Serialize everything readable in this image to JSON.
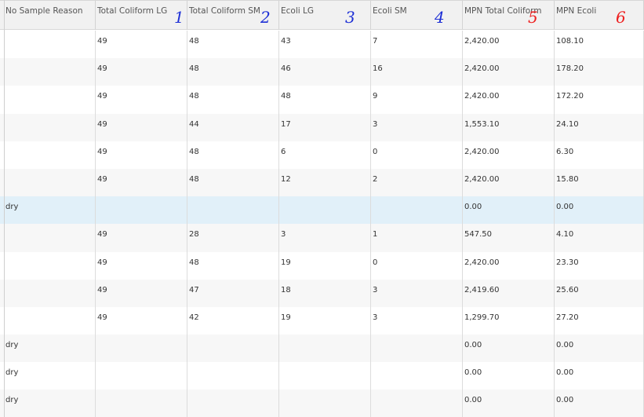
{
  "columns": [
    {
      "key": "reason",
      "label": "No Sample Reason",
      "note": ""
    },
    {
      "key": "tc_lg",
      "label": "Total Coliform LG",
      "note": "1"
    },
    {
      "key": "tc_sm",
      "label": "Total Coliform SM",
      "note": "2"
    },
    {
      "key": "ecoli_lg",
      "label": "Ecoli LG",
      "note": "3"
    },
    {
      "key": "ecoli_sm",
      "label": "Ecoli SM",
      "note": "4"
    },
    {
      "key": "mpn_tc",
      "label": "MPN Total Coliform",
      "note": "5"
    },
    {
      "key": "mpn_ecoli",
      "label": "MPN Ecoli",
      "note": "6"
    }
  ],
  "note_colors": {
    "blue": "#1d2fd6",
    "red": "#ee2020"
  },
  "rows": [
    {
      "reason": "",
      "tc_lg": "49",
      "tc_sm": "48",
      "ecoli_lg": "43",
      "ecoli_sm": "7",
      "mpn_tc": "2,420.00",
      "mpn_ecoli": "108.10",
      "selected": false
    },
    {
      "reason": "",
      "tc_lg": "49",
      "tc_sm": "48",
      "ecoli_lg": "46",
      "ecoli_sm": "16",
      "mpn_tc": "2,420.00",
      "mpn_ecoli": "178.20",
      "selected": false
    },
    {
      "reason": "",
      "tc_lg": "49",
      "tc_sm": "48",
      "ecoli_lg": "48",
      "ecoli_sm": "9",
      "mpn_tc": "2,420.00",
      "mpn_ecoli": "172.20",
      "selected": false
    },
    {
      "reason": "",
      "tc_lg": "49",
      "tc_sm": "44",
      "ecoli_lg": "17",
      "ecoli_sm": "3",
      "mpn_tc": "1,553.10",
      "mpn_ecoli": "24.10",
      "selected": false
    },
    {
      "reason": "",
      "tc_lg": "49",
      "tc_sm": "48",
      "ecoli_lg": "6",
      "ecoli_sm": "0",
      "mpn_tc": "2,420.00",
      "mpn_ecoli": "6.30",
      "selected": false
    },
    {
      "reason": "",
      "tc_lg": "49",
      "tc_sm": "48",
      "ecoli_lg": "12",
      "ecoli_sm": "2",
      "mpn_tc": "2,420.00",
      "mpn_ecoli": "15.80",
      "selected": false
    },
    {
      "reason": "dry",
      "tc_lg": "",
      "tc_sm": "",
      "ecoli_lg": "",
      "ecoli_sm": "",
      "mpn_tc": "0.00",
      "mpn_ecoli": "0.00",
      "selected": true
    },
    {
      "reason": "",
      "tc_lg": "49",
      "tc_sm": "28",
      "ecoli_lg": "3",
      "ecoli_sm": "1",
      "mpn_tc": "547.50",
      "mpn_ecoli": "4.10",
      "selected": false
    },
    {
      "reason": "",
      "tc_lg": "49",
      "tc_sm": "48",
      "ecoli_lg": "19",
      "ecoli_sm": "0",
      "mpn_tc": "2,420.00",
      "mpn_ecoli": "23.30",
      "selected": false
    },
    {
      "reason": "",
      "tc_lg": "49",
      "tc_sm": "47",
      "ecoli_lg": "18",
      "ecoli_sm": "3",
      "mpn_tc": "2,419.60",
      "mpn_ecoli": "25.60",
      "selected": false
    },
    {
      "reason": "",
      "tc_lg": "49",
      "tc_sm": "42",
      "ecoli_lg": "19",
      "ecoli_sm": "3",
      "mpn_tc": "1,299.70",
      "mpn_ecoli": "27.20",
      "selected": false
    },
    {
      "reason": "dry",
      "tc_lg": "",
      "tc_sm": "",
      "ecoli_lg": "",
      "ecoli_sm": "",
      "mpn_tc": "0.00",
      "mpn_ecoli": "0.00",
      "selected": false
    },
    {
      "reason": "dry",
      "tc_lg": "",
      "tc_sm": "",
      "ecoli_lg": "",
      "ecoli_sm": "",
      "mpn_tc": "0.00",
      "mpn_ecoli": "0.00",
      "selected": false
    },
    {
      "reason": "dry",
      "tc_lg": "",
      "tc_sm": "",
      "ecoli_lg": "",
      "ecoli_sm": "",
      "mpn_tc": "0.00",
      "mpn_ecoli": "0.00",
      "selected": false
    }
  ]
}
